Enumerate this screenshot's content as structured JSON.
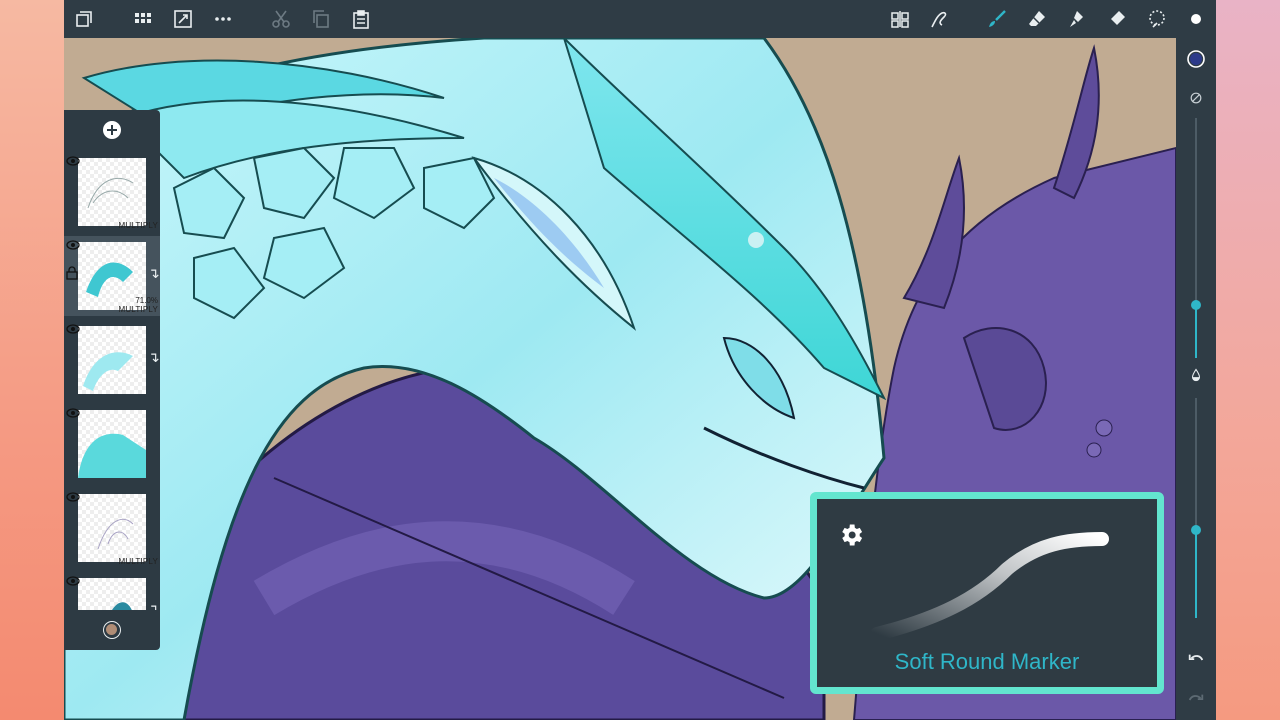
{
  "app": {
    "top_left_icons": [
      "layers-window-icon",
      "grid-icon",
      "transform-icon",
      "more-icon",
      "cut-icon",
      "copy-icon",
      "paste-icon"
    ],
    "top_right_icons": [
      "symmetry-icon",
      "stroke-icon",
      "brush-icon",
      "eraser-icon",
      "smudge-icon",
      "fill-icon",
      "selection-icon",
      "dot-icon"
    ]
  },
  "rail": {
    "color_swatch": "#2c3a8a",
    "size_slider_level": 0.78,
    "opacity_slider_level": 0.6
  },
  "layers": {
    "items": [
      {
        "mode": "MULTIPLY",
        "opacity": "",
        "locked": false,
        "clipped": false,
        "visible": true
      },
      {
        "mode": "MULTIPLY",
        "opacity": "71.0%",
        "locked": true,
        "clipped": true,
        "visible": true
      },
      {
        "mode": "",
        "opacity": "",
        "locked": false,
        "clipped": true,
        "visible": true
      },
      {
        "mode": "",
        "opacity": "",
        "locked": false,
        "clipped": false,
        "visible": true
      },
      {
        "mode": "MULTIPLY",
        "opacity": "",
        "locked": false,
        "clipped": false,
        "visible": true
      },
      {
        "mode": "",
        "opacity": "",
        "locked": false,
        "clipped": true,
        "visible": true
      }
    ],
    "bottom_color": "#b08d76"
  },
  "brush_popup": {
    "name": "Soft Round Marker",
    "border_color": "#63e5cf"
  }
}
